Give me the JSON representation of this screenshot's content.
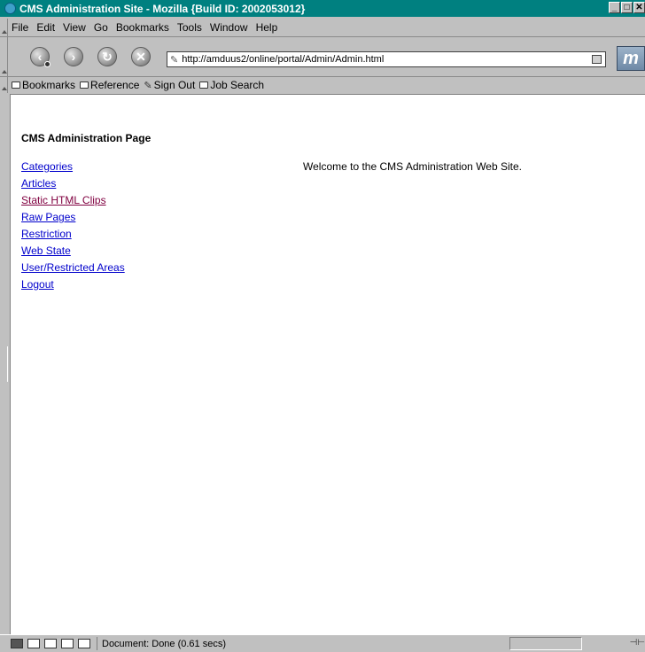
{
  "window": {
    "title": "CMS Administration Site - Mozilla {Build ID: 2002053012}",
    "controls": [
      "_",
      "□",
      "✕"
    ]
  },
  "menubar": {
    "items": [
      "File",
      "Edit",
      "View",
      "Go",
      "Bookmarks",
      "Tools",
      "Window",
      "Help"
    ]
  },
  "navbar": {
    "back_icon": "back-arrow-icon",
    "forward_icon": "forward-arrow-icon",
    "reload_icon": "reload-icon",
    "stop_icon": "stop-icon",
    "url": "http://amduus2/online/portal/Admin/Admin.html",
    "throbber_letter": "m"
  },
  "bookmarks": {
    "items": [
      {
        "label": "Bookmarks",
        "icon": "folder-icon"
      },
      {
        "label": "Reference",
        "icon": "folder-icon"
      },
      {
        "label": "Sign Out",
        "icon": "link-icon"
      },
      {
        "label": "Job Search",
        "icon": "folder-icon"
      }
    ]
  },
  "page": {
    "heading": "CMS Administration Page",
    "links": [
      {
        "label": "Categories",
        "visited": false
      },
      {
        "label": "Articles",
        "visited": false
      },
      {
        "label": "Static HTML Clips",
        "visited": true
      },
      {
        "label": "Raw Pages",
        "visited": false
      },
      {
        "label": "Restriction",
        "visited": false
      },
      {
        "label": "Web State",
        "visited": false
      },
      {
        "label": "User/Restricted Areas",
        "visited": false
      },
      {
        "label": "Logout",
        "visited": false
      }
    ],
    "welcome": "Welcome to the CMS Administration Web Site."
  },
  "statusbar": {
    "text": "Document: Done (0.61 secs)"
  },
  "colors": {
    "titlebar": "#008080",
    "link": "#0000cc",
    "visited_link": "#800040",
    "chrome": "#c0c0c0"
  }
}
